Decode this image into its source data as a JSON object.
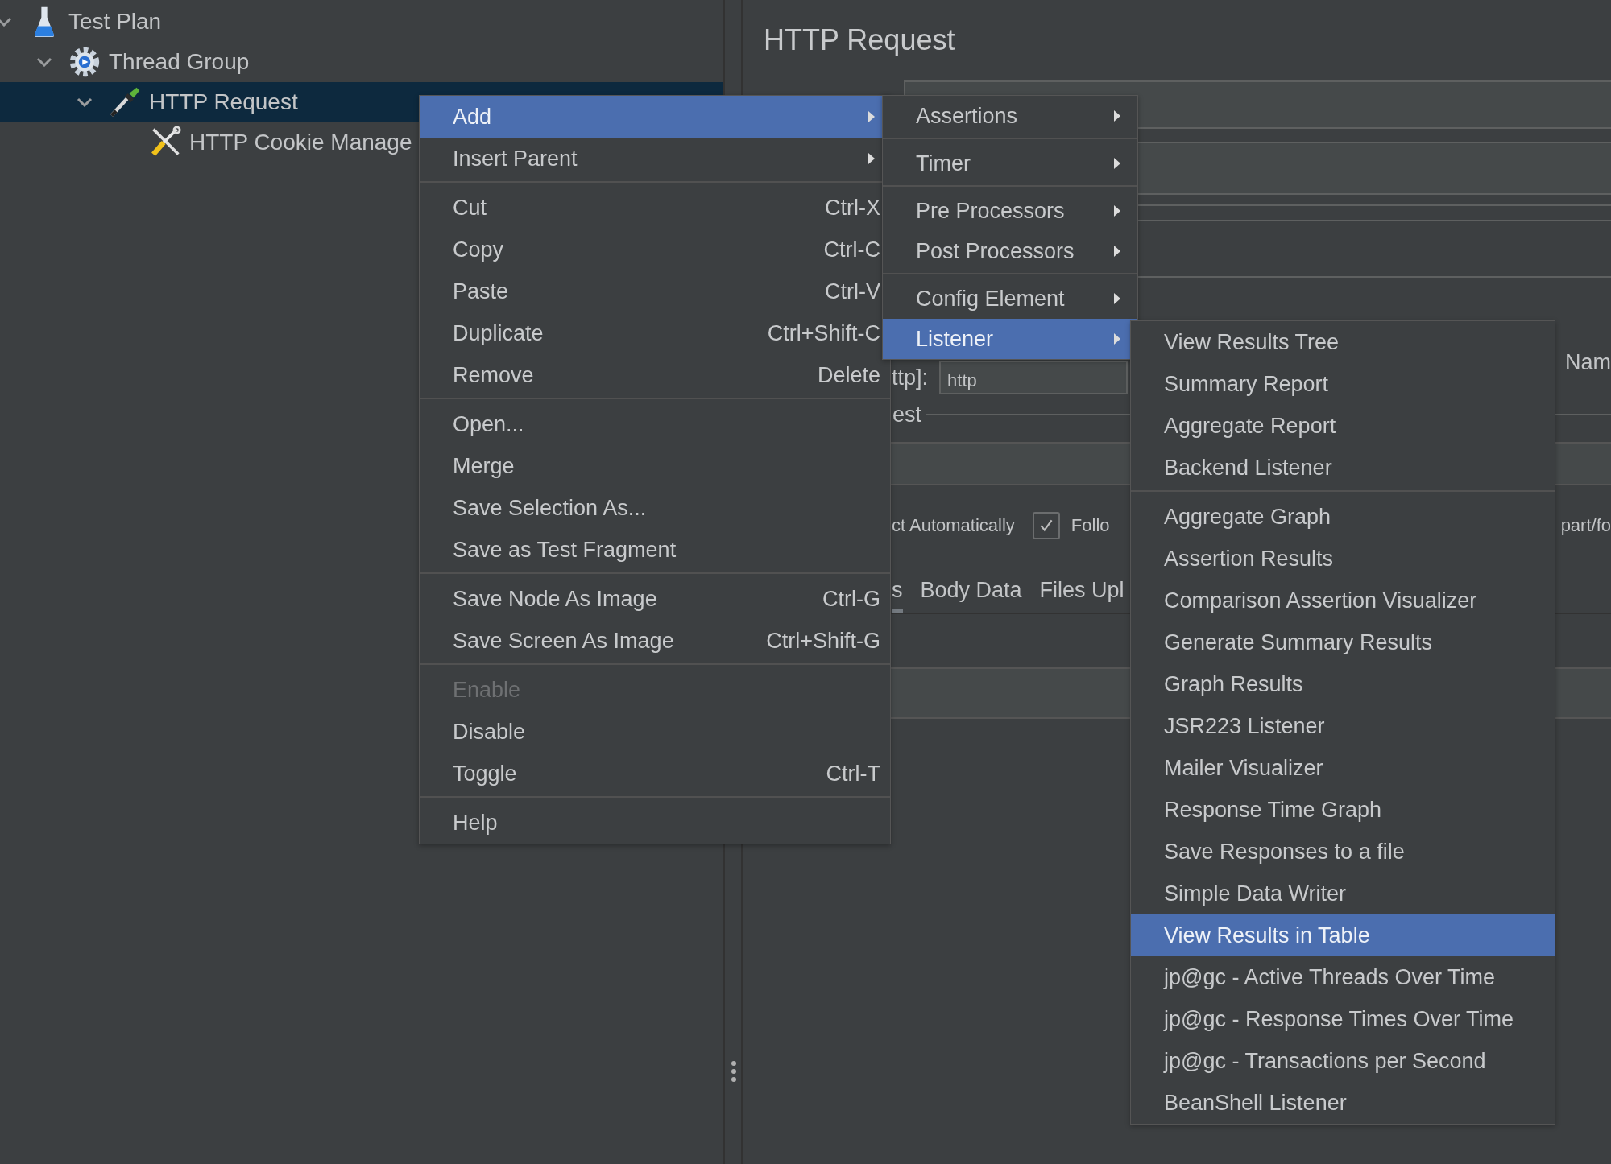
{
  "tree": [
    {
      "label": "Test Plan",
      "kind": "flask",
      "expanded": true,
      "selected": false,
      "children": [
        {
          "label": "Thread Group",
          "kind": "gear",
          "expanded": true,
          "selected": false,
          "children": [
            {
              "label": "HTTP Request",
              "kind": "pipette",
              "expanded": true,
              "selected": true,
              "children": [
                {
                  "label": "HTTP Cookie Manage",
                  "kind": "tools",
                  "selected": false
                }
              ]
            }
          ]
        }
      ]
    }
  ],
  "panel": {
    "title": "HTTP Request",
    "protocol_label": "ttp]:",
    "protocol_value": "http",
    "name_label": "Nam",
    "group_label": "est",
    "option_label": "ct Automatically",
    "follow_checked": true,
    "follow_label": "Follo",
    "multipart_label": "part/fo",
    "tabs": [
      {
        "label": "s",
        "selected": true
      },
      {
        "label": "Body Data",
        "selected": false
      },
      {
        "label": "Files Upl",
        "selected": false
      }
    ]
  },
  "context_menu": [
    {
      "kind": "item",
      "label": "Add",
      "submenu": true,
      "selected": true
    },
    {
      "kind": "item",
      "label": "Insert Parent",
      "submenu": true,
      "selected": false
    },
    {
      "kind": "separator"
    },
    {
      "kind": "item",
      "label": "Cut",
      "shortcut": "Ctrl-X",
      "selected": false
    },
    {
      "kind": "item",
      "label": "Copy",
      "shortcut": "Ctrl-C",
      "selected": false
    },
    {
      "kind": "item",
      "label": "Paste",
      "shortcut": "Ctrl-V",
      "selected": false
    },
    {
      "kind": "item",
      "label": "Duplicate",
      "shortcut": "Ctrl+Shift-C",
      "selected": false
    },
    {
      "kind": "item",
      "label": "Remove",
      "shortcut": "Delete",
      "selected": false
    },
    {
      "kind": "separator"
    },
    {
      "kind": "item",
      "label": "Open...",
      "selected": false
    },
    {
      "kind": "item",
      "label": "Merge",
      "selected": false
    },
    {
      "kind": "item",
      "label": "Save Selection As...",
      "selected": false
    },
    {
      "kind": "item",
      "label": "Save as Test Fragment",
      "selected": false
    },
    {
      "kind": "separator"
    },
    {
      "kind": "item",
      "label": "Save Node As Image",
      "shortcut": "Ctrl-G",
      "selected": false
    },
    {
      "kind": "item",
      "label": "Save Screen As Image",
      "shortcut": "Ctrl+Shift-G",
      "selected": false
    },
    {
      "kind": "separator"
    },
    {
      "kind": "item",
      "label": "Enable",
      "disabled": true,
      "selected": false
    },
    {
      "kind": "item",
      "label": "Disable",
      "selected": false
    },
    {
      "kind": "item",
      "label": "Toggle",
      "shortcut": "Ctrl-T",
      "selected": false
    },
    {
      "kind": "separator"
    },
    {
      "kind": "item",
      "label": "Help",
      "selected": false
    }
  ],
  "add_menu": [
    {
      "kind": "item",
      "label": "Assertions",
      "submenu": true,
      "selected": false
    },
    {
      "kind": "separator"
    },
    {
      "kind": "item",
      "label": "Timer",
      "submenu": true,
      "selected": false
    },
    {
      "kind": "separator"
    },
    {
      "kind": "item",
      "label": "Pre Processors",
      "submenu": true,
      "selected": false
    },
    {
      "kind": "item",
      "label": "Post Processors",
      "submenu": true,
      "selected": false
    },
    {
      "kind": "separator"
    },
    {
      "kind": "item",
      "label": "Config Element",
      "submenu": true,
      "selected": false
    },
    {
      "kind": "item",
      "label": "Listener",
      "submenu": true,
      "selected": true
    }
  ],
  "listener_menu": [
    {
      "kind": "item",
      "label": "View Results Tree",
      "selected": false
    },
    {
      "kind": "item",
      "label": "Summary Report",
      "selected": false
    },
    {
      "kind": "item",
      "label": "Aggregate Report",
      "selected": false
    },
    {
      "kind": "item",
      "label": "Backend Listener",
      "selected": false
    },
    {
      "kind": "separator"
    },
    {
      "kind": "item",
      "label": "Aggregate Graph",
      "selected": false
    },
    {
      "kind": "item",
      "label": "Assertion Results",
      "selected": false
    },
    {
      "kind": "item",
      "label": "Comparison Assertion Visualizer",
      "selected": false
    },
    {
      "kind": "item",
      "label": "Generate Summary Results",
      "selected": false
    },
    {
      "kind": "item",
      "label": "Graph Results",
      "selected": false
    },
    {
      "kind": "item",
      "label": "JSR223 Listener",
      "selected": false
    },
    {
      "kind": "item",
      "label": "Mailer Visualizer",
      "selected": false
    },
    {
      "kind": "item",
      "label": "Response Time Graph",
      "selected": false
    },
    {
      "kind": "item",
      "label": "Save Responses to a file",
      "selected": false
    },
    {
      "kind": "item",
      "label": "Simple Data Writer",
      "selected": false
    },
    {
      "kind": "item",
      "label": "View Results in Table",
      "selected": true
    },
    {
      "kind": "item",
      "label": "jp@gc - Active Threads Over Time",
      "selected": false
    },
    {
      "kind": "item",
      "label": "jp@gc - Response Times Over Time",
      "selected": false
    },
    {
      "kind": "item",
      "label": "jp@gc - Transactions per Second",
      "selected": false
    },
    {
      "kind": "item",
      "label": "BeanShell Listener",
      "selected": false
    }
  ]
}
